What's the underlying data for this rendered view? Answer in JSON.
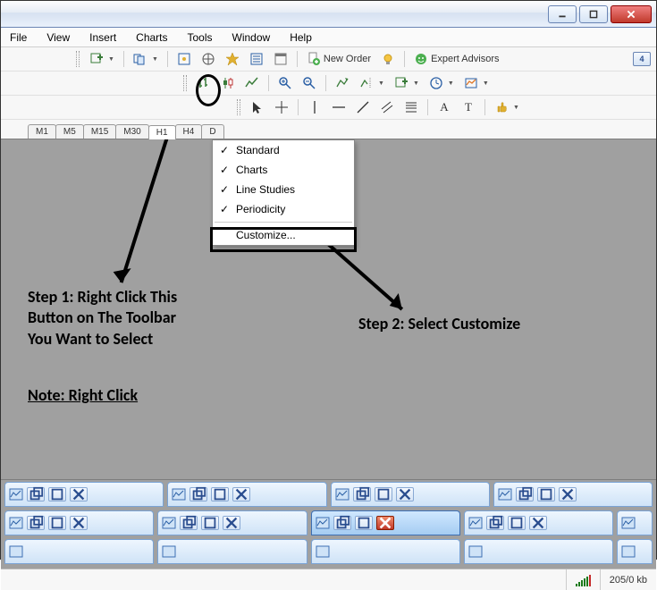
{
  "window": {
    "min_tooltip": "Minimize",
    "restore_tooltip": "Restore",
    "close_tooltip": "Close"
  },
  "menu": {
    "file": "File",
    "view": "View",
    "insert": "Insert",
    "charts": "Charts",
    "tools": "Tools",
    "window": "Window",
    "help": "Help"
  },
  "toolbar1": {
    "new_order": "New Order",
    "expert_advisors": "Expert Advisors",
    "indicator_value": "4"
  },
  "periods": [
    "M1",
    "M5",
    "M15",
    "M30",
    "H1",
    "H4",
    "D"
  ],
  "active_period_index": 4,
  "ctx": {
    "standard": "Standard",
    "charts": "Charts",
    "line_studies": "Line Studies",
    "periodicity": "Periodicity",
    "customize": "Customize..."
  },
  "annotations": {
    "step1_line1": "Step 1: Right Click This",
    "step1_line2": "Button on The Toolbar",
    "step1_line3": "You Want to Select",
    "step2": "Step 2: Select Customize",
    "note": "Note: Right Click"
  },
  "status": {
    "kb": "205/0 kb"
  },
  "icons": {
    "new_window": "new-window-icon",
    "print": "print-icon",
    "chart": "chart-icon",
    "cursor": "cursor-icon",
    "star": "star-icon",
    "list": "list-icon",
    "search": "search-icon",
    "doc": "doc-icon",
    "lightbulb": "lightbulb-icon",
    "ea": "ea-icon"
  }
}
